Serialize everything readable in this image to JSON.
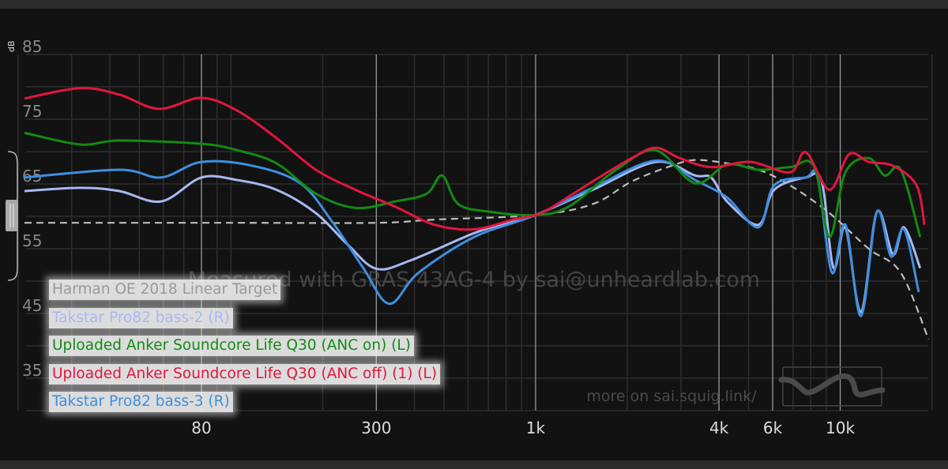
{
  "chart_data": {
    "type": "line",
    "title": "",
    "xlabel": "",
    "ylabel": "dB",
    "x_scale": "log",
    "xlim": [
      20,
      20000
    ],
    "ylim": [
      30,
      85
    ],
    "grid": true,
    "legend_position": "bottom-left",
    "y_ticks": [
      "85",
      "75",
      "65",
      "55",
      "45",
      "35"
    ],
    "x_ticks": [
      "80",
      "300",
      "1k",
      "4k",
      "6k",
      "10k"
    ],
    "watermark": "Measured with GRAS 43AG-4 by sai@unheardlab.com",
    "footer_link": "more on sai.squig.link/",
    "series": [
      {
        "name": "Harman OE 2018 Linear Target",
        "color": "#bdbdbd",
        "dashed": true,
        "points": [
          [
            21,
            59
          ],
          [
            100,
            59
          ],
          [
            300,
            59
          ],
          [
            466,
            59.5
          ],
          [
            1000,
            60.2
          ],
          [
            1540,
            61.9
          ],
          [
            2070,
            65.4
          ],
          [
            2790,
            67.8
          ],
          [
            3340,
            68.7
          ],
          [
            4250,
            68.2
          ],
          [
            5390,
            67.2
          ],
          [
            6840,
            64.8
          ],
          [
            9220,
            60.5
          ],
          [
            12400,
            55
          ],
          [
            15800,
            51.3
          ],
          [
            19500,
            41
          ]
        ]
      },
      {
        "name": "Takstar Pro82 bass-2 (R)",
        "color": "#a9b8f2",
        "points": [
          [
            21,
            63.9
          ],
          [
            32,
            64.4
          ],
          [
            43,
            63.9
          ],
          [
            59,
            62.3
          ],
          [
            80,
            66
          ],
          [
            105,
            65.6
          ],
          [
            141,
            64.1
          ],
          [
            190,
            60.5
          ],
          [
            242,
            55.6
          ],
          [
            300,
            51.9
          ],
          [
            389,
            53.2
          ],
          [
            628,
            57.4
          ],
          [
            846,
            59.3
          ],
          [
            1000,
            60.2
          ],
          [
            1540,
            64.1
          ],
          [
            2480,
            68.4
          ],
          [
            3340,
            66.3
          ],
          [
            3770,
            66
          ],
          [
            4250,
            62.3
          ],
          [
            5390,
            58.7
          ],
          [
            6070,
            64.1
          ],
          [
            7710,
            66
          ],
          [
            8690,
            65.4
          ],
          [
            9510,
            52
          ],
          [
            10400,
            58.3
          ],
          [
            11700,
            45.2
          ],
          [
            13200,
            60.7
          ],
          [
            14900,
            54.1
          ],
          [
            16200,
            58.3
          ],
          [
            18300,
            52
          ]
        ]
      },
      {
        "name": "Uploaded Anker Soundcore Life Q30 (ANC on) (L)",
        "color": "#138a13",
        "points": [
          [
            21,
            72.9
          ],
          [
            32,
            71.1
          ],
          [
            43,
            71.7
          ],
          [
            80,
            71.2
          ],
          [
            105,
            70.2
          ],
          [
            141,
            68.2
          ],
          [
            190,
            63.5
          ],
          [
            256,
            61.3
          ],
          [
            346,
            62.3
          ],
          [
            439,
            63.5
          ],
          [
            494,
            66.3
          ],
          [
            557,
            61.9
          ],
          [
            708,
            60.7
          ],
          [
            1000,
            60.2
          ],
          [
            1285,
            61.5
          ],
          [
            1840,
            67.2
          ],
          [
            2480,
            70.2
          ],
          [
            3340,
            65.1
          ],
          [
            4250,
            68
          ],
          [
            5390,
            67.2
          ],
          [
            6840,
            67.6
          ],
          [
            8190,
            67.8
          ],
          [
            9220,
            56.8
          ],
          [
            10400,
            66.8
          ],
          [
            12400,
            69
          ],
          [
            14000,
            66.3
          ],
          [
            15800,
            67.2
          ],
          [
            18300,
            56.8
          ]
        ]
      },
      {
        "name": "Uploaded Anker Soundcore Life Q30 (ANC off) (1) (L)",
        "color": "#e2163f",
        "points": [
          [
            21,
            78.2
          ],
          [
            32,
            79.8
          ],
          [
            43,
            78.8
          ],
          [
            58,
            76.6
          ],
          [
            80,
            78.3
          ],
          [
            105,
            76.3
          ],
          [
            141,
            72.1
          ],
          [
            190,
            67.2
          ],
          [
            256,
            64.1
          ],
          [
            346,
            61.5
          ],
          [
            466,
            58.7
          ],
          [
            628,
            58
          ],
          [
            846,
            59.5
          ],
          [
            1000,
            60.2
          ],
          [
            1140,
            61.5
          ],
          [
            1540,
            65.4
          ],
          [
            2070,
            69
          ],
          [
            2480,
            70.6
          ],
          [
            2970,
            69
          ],
          [
            3770,
            67.6
          ],
          [
            5070,
            68.4
          ],
          [
            6840,
            66.8
          ],
          [
            7710,
            69.9
          ],
          [
            9220,
            64.1
          ],
          [
            10700,
            69.6
          ],
          [
            12400,
            68.4
          ],
          [
            14900,
            67.8
          ],
          [
            17800,
            64.8
          ],
          [
            18900,
            58.7
          ]
        ]
      },
      {
        "name": "Takstar Pro82 bass-3 (R)",
        "color": "#3d8fe0",
        "points": [
          [
            21,
            66
          ],
          [
            43,
            67.2
          ],
          [
            59,
            66
          ],
          [
            80,
            68.4
          ],
          [
            118,
            67.8
          ],
          [
            169,
            65.1
          ],
          [
            214,
            59.3
          ],
          [
            272,
            52
          ],
          [
            331,
            46.5
          ],
          [
            413,
            51.3
          ],
          [
            628,
            56.8
          ],
          [
            1000,
            60.2
          ],
          [
            1540,
            64.4
          ],
          [
            2480,
            68.6
          ],
          [
            3340,
            65.6
          ],
          [
            4250,
            62.9
          ],
          [
            5390,
            58.3
          ],
          [
            6070,
            64.8
          ],
          [
            7710,
            66
          ],
          [
            8430,
            66
          ],
          [
            9390,
            51.3
          ],
          [
            10400,
            58.7
          ],
          [
            11700,
            44.6
          ],
          [
            13200,
            60.7
          ],
          [
            14700,
            53.8
          ],
          [
            16200,
            58
          ],
          [
            18100,
            48.3
          ]
        ]
      }
    ]
  }
}
